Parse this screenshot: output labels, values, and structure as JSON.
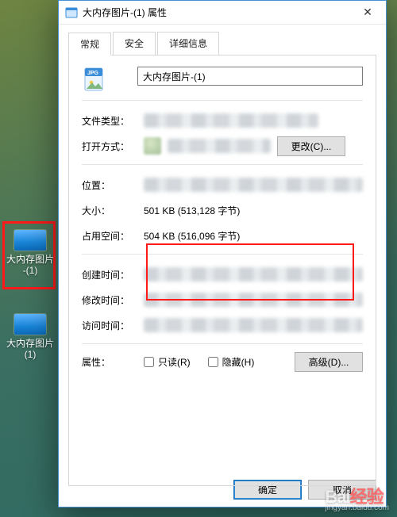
{
  "desktop": {
    "icon_selected": {
      "label_line1": "大内存图片",
      "label_line2": "-(1)"
    },
    "icon_other": {
      "label_line1": "大内存图片",
      "label_line2": "(1)"
    }
  },
  "window": {
    "title": "大内存图片-(1) 属性",
    "close_glyph": "✕"
  },
  "tabs": {
    "general": "常规",
    "security": "安全",
    "details": "详细信息"
  },
  "file": {
    "name": "大内存图片-(1)"
  },
  "labels": {
    "file_type": "文件类型：",
    "opens_with": "打开方式：",
    "change_btn": "更改(C)...",
    "location": "位置：",
    "size": "大小：",
    "size_ondisk": "占用空间：",
    "created": "创建时间：",
    "modified": "修改时间：",
    "accessed": "访问时间：",
    "attributes": "属性：",
    "readonly": "只读(R)",
    "hidden": "隐藏(H)",
    "advanced": "高级(D)..."
  },
  "values": {
    "size": "501 KB (513,128 字节)",
    "size_ondisk": "504 KB (516,096 字节)"
  },
  "buttons": {
    "ok": "确定",
    "cancel": "取消"
  },
  "watermark": {
    "brand": "Bai",
    "brand_tail": "经验",
    "sub": "jingyan.baidu.com"
  }
}
